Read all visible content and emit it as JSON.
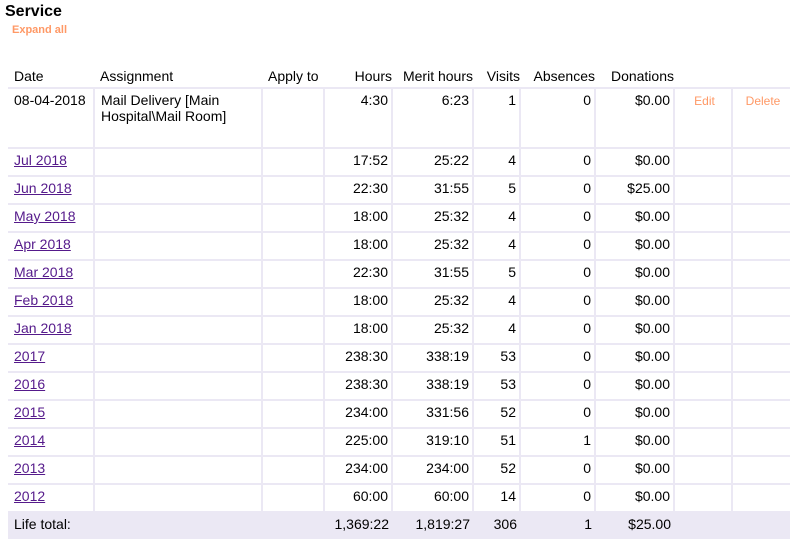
{
  "title": "Service",
  "expand_all": "Expand all",
  "headers": {
    "date": "Date",
    "assignment": "Assignment",
    "apply_to": "Apply to",
    "hours": "Hours",
    "merit_hours": "Merit hours",
    "visits": "Visits",
    "absences": "Absences",
    "donations": "Donations"
  },
  "first_row": {
    "date": "08-04-2018",
    "assignment": "Mail Delivery [Main Hospital\\Mail Room]",
    "hours": "4:30",
    "merit": "6:23",
    "visits": "1",
    "absences": "0",
    "donations": "$0.00",
    "edit": "Edit",
    "delete": "Delete"
  },
  "rows": [
    {
      "label": "Jul 2018",
      "hours": "17:52",
      "merit": "25:22",
      "visits": "4",
      "absences": "0",
      "donations": "$0.00"
    },
    {
      "label": "Jun 2018",
      "hours": "22:30",
      "merit": "31:55",
      "visits": "5",
      "absences": "0",
      "donations": "$25.00"
    },
    {
      "label": "May 2018",
      "hours": "18:00",
      "merit": "25:32",
      "visits": "4",
      "absences": "0",
      "donations": "$0.00"
    },
    {
      "label": "Apr 2018",
      "hours": "18:00",
      "merit": "25:32",
      "visits": "4",
      "absences": "0",
      "donations": "$0.00"
    },
    {
      "label": "Mar 2018",
      "hours": "22:30",
      "merit": "31:55",
      "visits": "5",
      "absences": "0",
      "donations": "$0.00"
    },
    {
      "label": "Feb 2018",
      "hours": "18:00",
      "merit": "25:32",
      "visits": "4",
      "absences": "0",
      "donations": "$0.00"
    },
    {
      "label": "Jan 2018",
      "hours": "18:00",
      "merit": "25:32",
      "visits": "4",
      "absences": "0",
      "donations": "$0.00"
    },
    {
      "label": "2017",
      "hours": "238:30",
      "merit": "338:19",
      "visits": "53",
      "absences": "0",
      "donations": "$0.00"
    },
    {
      "label": "2016",
      "hours": "238:30",
      "merit": "338:19",
      "visits": "53",
      "absences": "0",
      "donations": "$0.00"
    },
    {
      "label": "2015",
      "hours": "234:00",
      "merit": "331:56",
      "visits": "52",
      "absences": "0",
      "donations": "$0.00"
    },
    {
      "label": "2014",
      "hours": "225:00",
      "merit": "319:10",
      "visits": "51",
      "absences": "1",
      "donations": "$0.00"
    },
    {
      "label": "2013",
      "hours": "234:00",
      "merit": "234:00",
      "visits": "52",
      "absences": "0",
      "donations": "$0.00"
    },
    {
      "label": "2012",
      "hours": "60:00",
      "merit": "60:00",
      "visits": "14",
      "absences": "0",
      "donations": "$0.00"
    }
  ],
  "total": {
    "label": "Life total:",
    "hours": "1,369:22",
    "merit": "1,819:27",
    "visits": "306",
    "absences": "1",
    "donations": "$25.00"
  },
  "colors": {
    "accent": "#ff9966",
    "link": "#551a8b",
    "border": "#ebe8f4"
  }
}
